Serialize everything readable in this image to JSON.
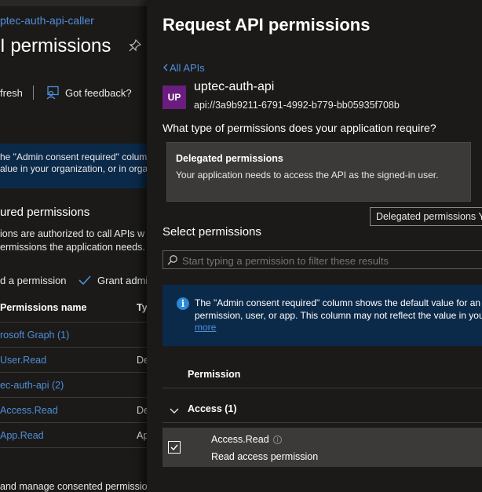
{
  "background": {
    "app_name": "ptec-auth-api-caller",
    "page_title": "I permissions",
    "toolbar": {
      "refresh_label": "fresh",
      "feedback_label": "Got feedback?"
    },
    "banner_lines": [
      "he \"Admin consent required\" colum",
      "alue in your organization, or in orga"
    ],
    "section_title": "ured permissions",
    "section_desc": [
      "ions are authorized to call APIs w",
      "ermissions the application needs."
    ],
    "actions": {
      "add_label": "d a permission",
      "grant_label": "Grant admi"
    },
    "table": {
      "col_name": "Permissions name",
      "col_type": "Ty",
      "rows": [
        {
          "name": "rosoft Graph (1)",
          "type": ""
        },
        {
          "name": "User.Read",
          "type": "De"
        },
        {
          "name": "ec-auth-api (2)",
          "type": ""
        },
        {
          "name": "Access.Read",
          "type": "De"
        },
        {
          "name": "App.Read",
          "type": "Ap"
        }
      ]
    },
    "footer_text": "and manage consented permissio"
  },
  "panel": {
    "title": "Request API permissions",
    "back_link": "All APIs",
    "api": {
      "tile_initials": "UP",
      "name": "uptec-auth-api",
      "uri": "api://3a9b9211-6791-4992-b779-bb05935f708b"
    },
    "question": "What type of permissions does your application require?",
    "option": {
      "title": "Delegated permissions",
      "desc": "Your application needs to access the API as the signed-in user."
    },
    "tooltip": "Delegated permissions Yo",
    "select_heading": "Select permissions",
    "search": {
      "placeholder": "Start typing a permission to filter these results"
    },
    "info": {
      "line1": "The \"Admin consent required\" column shows the default value for an",
      "line2": "permission, user, or app. This column may not reflect the value in you",
      "link": "more"
    },
    "table": {
      "col_permission": "Permission",
      "group_label": "Access (1)",
      "row": {
        "name": "Access.Read",
        "desc": "Read access permission",
        "checked": true
      }
    }
  },
  "colors": {
    "accent_link": "#4f8ed9",
    "tile": "#6b1d7f",
    "info_banner": "#0b2a4a"
  }
}
